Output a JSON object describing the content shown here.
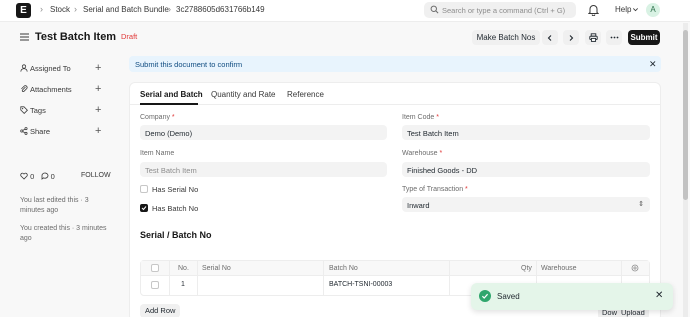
{
  "navbar": {
    "logo_letter": "E",
    "breadcrumbs": [
      "Stock",
      "Serial and Batch Bundle",
      "3c2788605d631766b149"
    ],
    "search_placeholder": "Search or type a command (Ctrl + G)",
    "help_label": "Help",
    "avatar_letter": "A"
  },
  "header": {
    "title": "Test Batch Item",
    "status": "Draft",
    "make_batch_nos_label": "Make Batch Nos",
    "prev_icon": "chevron-left-icon",
    "next_icon": "chevron-right-icon",
    "print_icon": "printer-icon",
    "more_icon": "ellipsis-icon",
    "submit_label": "Submit"
  },
  "sidebar": {
    "items": [
      {
        "label": "Assigned To",
        "icon": "user-icon"
      },
      {
        "label": "Attachments",
        "icon": "paperclip-icon"
      },
      {
        "label": "Tags",
        "icon": "tag-icon"
      },
      {
        "label": "Share",
        "icon": "share-icon"
      }
    ],
    "likes": "0",
    "comments": "0",
    "follow_label": "FOLLOW",
    "last_edited": "You last edited this · 3 minutes ago",
    "created": "You created this · 3 minutes ago"
  },
  "alert": {
    "text": "Submit this document to confirm"
  },
  "tabs": [
    {
      "label": "Serial and Batch",
      "active": true
    },
    {
      "label": "Quantity and Rate",
      "active": false
    },
    {
      "label": "Reference",
      "active": false
    }
  ],
  "form": {
    "company": {
      "label": "Company",
      "value": "Demo (Demo)"
    },
    "item_name": {
      "label": "Item Name",
      "placeholder": "Test Batch Item"
    },
    "has_serial_no": {
      "label": "Has Serial No",
      "checked": false
    },
    "has_batch_no": {
      "label": "Has Batch No",
      "checked": true
    },
    "item_code": {
      "label": "Item Code",
      "value": "Test Batch Item"
    },
    "warehouse": {
      "label": "Warehouse",
      "value": "Finished Goods - DD"
    },
    "type_of_transaction": {
      "label": "Type of Transaction",
      "value": "Inward"
    },
    "required_mark": "*"
  },
  "section": {
    "title": "Serial / Batch No"
  },
  "table": {
    "headers": {
      "no": "No.",
      "serial_no": "Serial No",
      "batch_no": "Batch No",
      "qty": "Qty",
      "warehouse": "Warehouse"
    },
    "rows": [
      {
        "no": "1",
        "serial_no": "",
        "batch_no": "BATCH-TSNI-00003",
        "qty": "",
        "warehouse": ""
      }
    ],
    "add_row_label": "Add Row",
    "download_label": "Download",
    "upload_label": "Upload"
  },
  "toast": {
    "text": "Saved"
  },
  "colors": {
    "primary": "#171717",
    "draft": "#e03636",
    "alert_bg": "#e8f4fd",
    "alert_text": "#0f4c81",
    "toast_bg": "#e4f5e9",
    "success": "#30a66d"
  }
}
